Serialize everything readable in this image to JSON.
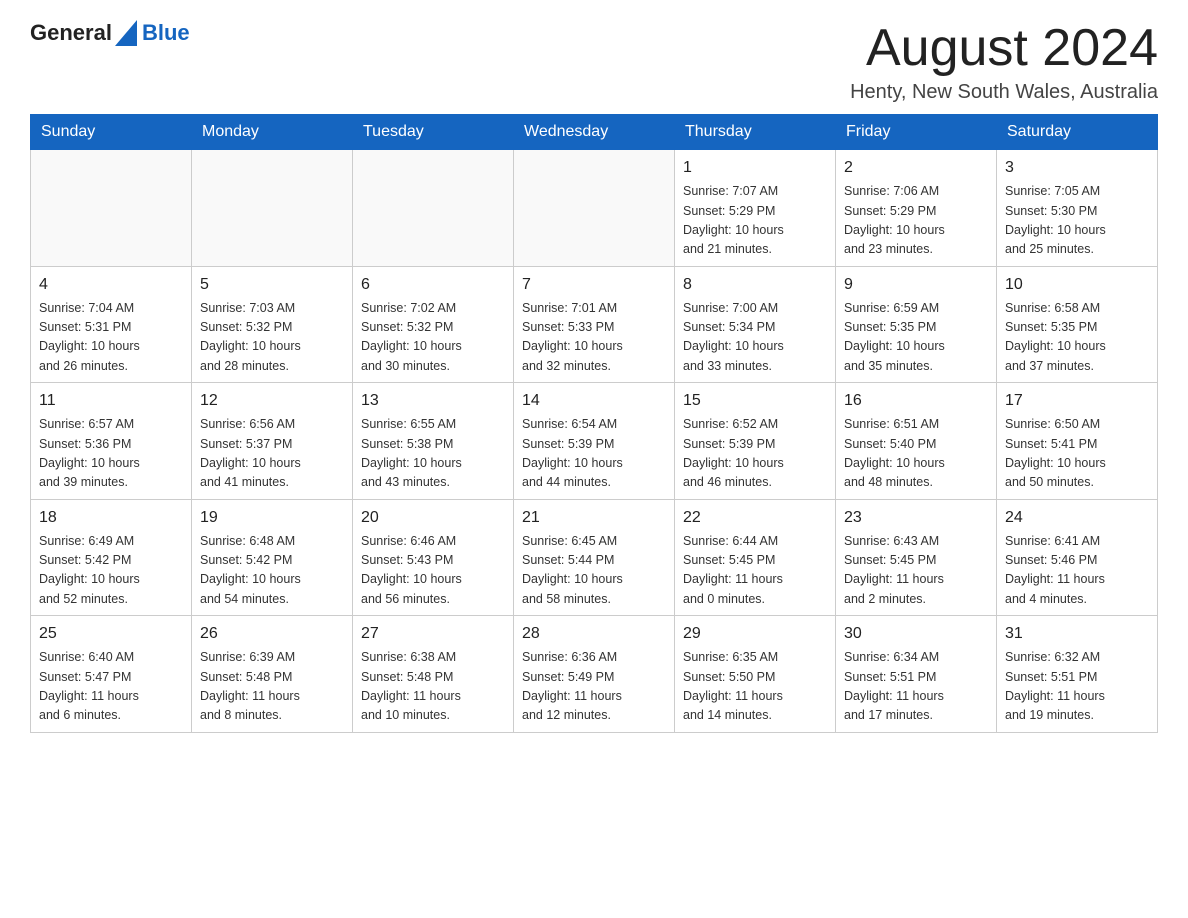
{
  "header": {
    "logo": {
      "general": "General",
      "blue": "Blue"
    },
    "title": "August 2024",
    "location": "Henty, New South Wales, Australia"
  },
  "weekdays": [
    "Sunday",
    "Monday",
    "Tuesday",
    "Wednesday",
    "Thursday",
    "Friday",
    "Saturday"
  ],
  "weeks": [
    [
      {
        "day": "",
        "info": ""
      },
      {
        "day": "",
        "info": ""
      },
      {
        "day": "",
        "info": ""
      },
      {
        "day": "",
        "info": ""
      },
      {
        "day": "1",
        "info": "Sunrise: 7:07 AM\nSunset: 5:29 PM\nDaylight: 10 hours\nand 21 minutes."
      },
      {
        "day": "2",
        "info": "Sunrise: 7:06 AM\nSunset: 5:29 PM\nDaylight: 10 hours\nand 23 minutes."
      },
      {
        "day": "3",
        "info": "Sunrise: 7:05 AM\nSunset: 5:30 PM\nDaylight: 10 hours\nand 25 minutes."
      }
    ],
    [
      {
        "day": "4",
        "info": "Sunrise: 7:04 AM\nSunset: 5:31 PM\nDaylight: 10 hours\nand 26 minutes."
      },
      {
        "day": "5",
        "info": "Sunrise: 7:03 AM\nSunset: 5:32 PM\nDaylight: 10 hours\nand 28 minutes."
      },
      {
        "day": "6",
        "info": "Sunrise: 7:02 AM\nSunset: 5:32 PM\nDaylight: 10 hours\nand 30 minutes."
      },
      {
        "day": "7",
        "info": "Sunrise: 7:01 AM\nSunset: 5:33 PM\nDaylight: 10 hours\nand 32 minutes."
      },
      {
        "day": "8",
        "info": "Sunrise: 7:00 AM\nSunset: 5:34 PM\nDaylight: 10 hours\nand 33 minutes."
      },
      {
        "day": "9",
        "info": "Sunrise: 6:59 AM\nSunset: 5:35 PM\nDaylight: 10 hours\nand 35 minutes."
      },
      {
        "day": "10",
        "info": "Sunrise: 6:58 AM\nSunset: 5:35 PM\nDaylight: 10 hours\nand 37 minutes."
      }
    ],
    [
      {
        "day": "11",
        "info": "Sunrise: 6:57 AM\nSunset: 5:36 PM\nDaylight: 10 hours\nand 39 minutes."
      },
      {
        "day": "12",
        "info": "Sunrise: 6:56 AM\nSunset: 5:37 PM\nDaylight: 10 hours\nand 41 minutes."
      },
      {
        "day": "13",
        "info": "Sunrise: 6:55 AM\nSunset: 5:38 PM\nDaylight: 10 hours\nand 43 minutes."
      },
      {
        "day": "14",
        "info": "Sunrise: 6:54 AM\nSunset: 5:39 PM\nDaylight: 10 hours\nand 44 minutes."
      },
      {
        "day": "15",
        "info": "Sunrise: 6:52 AM\nSunset: 5:39 PM\nDaylight: 10 hours\nand 46 minutes."
      },
      {
        "day": "16",
        "info": "Sunrise: 6:51 AM\nSunset: 5:40 PM\nDaylight: 10 hours\nand 48 minutes."
      },
      {
        "day": "17",
        "info": "Sunrise: 6:50 AM\nSunset: 5:41 PM\nDaylight: 10 hours\nand 50 minutes."
      }
    ],
    [
      {
        "day": "18",
        "info": "Sunrise: 6:49 AM\nSunset: 5:42 PM\nDaylight: 10 hours\nand 52 minutes."
      },
      {
        "day": "19",
        "info": "Sunrise: 6:48 AM\nSunset: 5:42 PM\nDaylight: 10 hours\nand 54 minutes."
      },
      {
        "day": "20",
        "info": "Sunrise: 6:46 AM\nSunset: 5:43 PM\nDaylight: 10 hours\nand 56 minutes."
      },
      {
        "day": "21",
        "info": "Sunrise: 6:45 AM\nSunset: 5:44 PM\nDaylight: 10 hours\nand 58 minutes."
      },
      {
        "day": "22",
        "info": "Sunrise: 6:44 AM\nSunset: 5:45 PM\nDaylight: 11 hours\nand 0 minutes."
      },
      {
        "day": "23",
        "info": "Sunrise: 6:43 AM\nSunset: 5:45 PM\nDaylight: 11 hours\nand 2 minutes."
      },
      {
        "day": "24",
        "info": "Sunrise: 6:41 AM\nSunset: 5:46 PM\nDaylight: 11 hours\nand 4 minutes."
      }
    ],
    [
      {
        "day": "25",
        "info": "Sunrise: 6:40 AM\nSunset: 5:47 PM\nDaylight: 11 hours\nand 6 minutes."
      },
      {
        "day": "26",
        "info": "Sunrise: 6:39 AM\nSunset: 5:48 PM\nDaylight: 11 hours\nand 8 minutes."
      },
      {
        "day": "27",
        "info": "Sunrise: 6:38 AM\nSunset: 5:48 PM\nDaylight: 11 hours\nand 10 minutes."
      },
      {
        "day": "28",
        "info": "Sunrise: 6:36 AM\nSunset: 5:49 PM\nDaylight: 11 hours\nand 12 minutes."
      },
      {
        "day": "29",
        "info": "Sunrise: 6:35 AM\nSunset: 5:50 PM\nDaylight: 11 hours\nand 14 minutes."
      },
      {
        "day": "30",
        "info": "Sunrise: 6:34 AM\nSunset: 5:51 PM\nDaylight: 11 hours\nand 17 minutes."
      },
      {
        "day": "31",
        "info": "Sunrise: 6:32 AM\nSunset: 5:51 PM\nDaylight: 11 hours\nand 19 minutes."
      }
    ]
  ]
}
